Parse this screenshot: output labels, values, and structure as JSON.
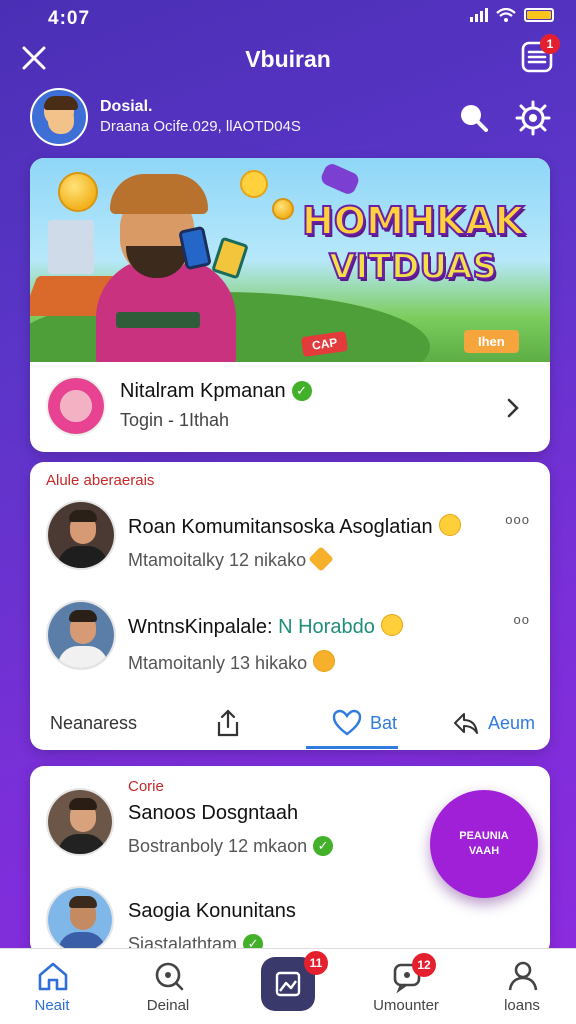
{
  "status_bar": {
    "time": "4:07"
  },
  "header": {
    "title": "Vbuiran",
    "menu_badge": "1"
  },
  "profile": {
    "name": "Dosial.",
    "subtitle": "Draana Ocife.029, llAOTD04S"
  },
  "banner": {
    "title_line1": "HOMHKAK",
    "title_line2": "VITDUAS",
    "tag_left": "CAP",
    "tag_right": "Ihen"
  },
  "community": {
    "name": "Nitalram Kpmanan",
    "subtitle": "Togin - 1Ithah"
  },
  "posts": {
    "section_label": "Alule aberaerais",
    "items": [
      {
        "title": "Roan Komumitansoska Asoglatian",
        "meta": "Mtamoitalky 12 nikako",
        "more": "ooo"
      },
      {
        "title_main": "WntnsKinpalale:",
        "title_accent": "N Horabdo",
        "meta": "Mtamoitanly 13 hikako",
        "more": "oo"
      }
    ],
    "actions": {
      "left": "Neanaress",
      "like": "Bat",
      "right": "Aeum"
    }
  },
  "friends": {
    "section_label": "Corie",
    "items": [
      {
        "name": "Sanoos Dosgntaah",
        "subtitle": "Bostranboly 12 mkaon"
      },
      {
        "name": "Saogia Konunitans",
        "subtitle": "Sjastalathtam"
      }
    ]
  },
  "fab": {
    "line1": "PEAUNIA",
    "line2": "VAAH"
  },
  "bottom_nav": {
    "items": [
      {
        "label": "Neait"
      },
      {
        "label": "Deinal"
      },
      {
        "label": "",
        "badge": "11"
      },
      {
        "label": "Umounter",
        "badge": "12"
      },
      {
        "label": "loans"
      }
    ]
  },
  "colors": {
    "accent": "#2f7be0",
    "brand_purple": "#5b35c8",
    "badge_red": "#e5202e",
    "verified_green": "#43b02a"
  }
}
